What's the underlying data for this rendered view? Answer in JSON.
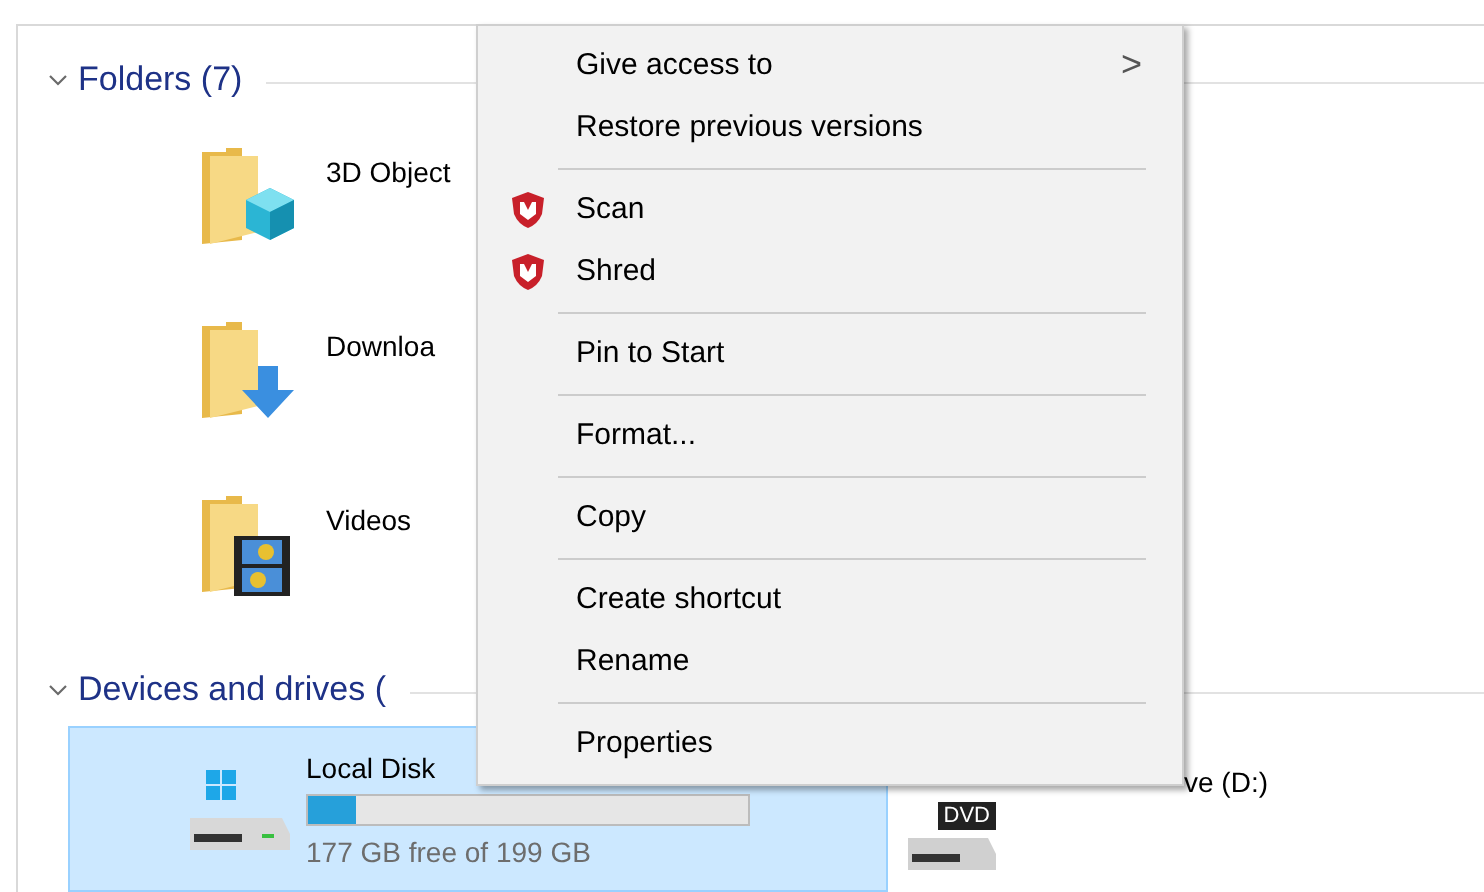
{
  "folders": {
    "title": "Folders (7)",
    "expanded": true,
    "items": [
      {
        "label": "3D Object",
        "kind": "cube"
      },
      {
        "label": "Downloa",
        "kind": "download"
      },
      {
        "label": "Videos",
        "kind": "video"
      }
    ]
  },
  "devices": {
    "title": "Devices and drives (",
    "expanded": true,
    "drives": [
      {
        "label": "Local Disk",
        "kind": "disk",
        "selected": true,
        "level": 0.11,
        "free_text": "177 GB free of 199 GB"
      },
      {
        "label": "ve (D:)",
        "kind": "dvd",
        "selected": false,
        "badge": "DVD"
      }
    ]
  },
  "context_menu": {
    "items": [
      {
        "kind": "submenu",
        "label": "Give access to",
        "arrow": ">"
      },
      {
        "kind": "plain",
        "label": "Restore previous versions"
      },
      {
        "kind": "separator"
      },
      {
        "kind": "shield",
        "label": "Scan"
      },
      {
        "kind": "shield",
        "label": "Shred"
      },
      {
        "kind": "separator"
      },
      {
        "kind": "plain",
        "label": "Pin to Start"
      },
      {
        "kind": "separator"
      },
      {
        "kind": "plain",
        "label": "Format..."
      },
      {
        "kind": "separator"
      },
      {
        "kind": "plain",
        "label": "Copy"
      },
      {
        "kind": "separator"
      },
      {
        "kind": "plain",
        "label": "Create shortcut"
      },
      {
        "kind": "plain",
        "label": "Rename"
      },
      {
        "kind": "separator"
      },
      {
        "kind": "plain",
        "label": "Properties"
      }
    ]
  }
}
